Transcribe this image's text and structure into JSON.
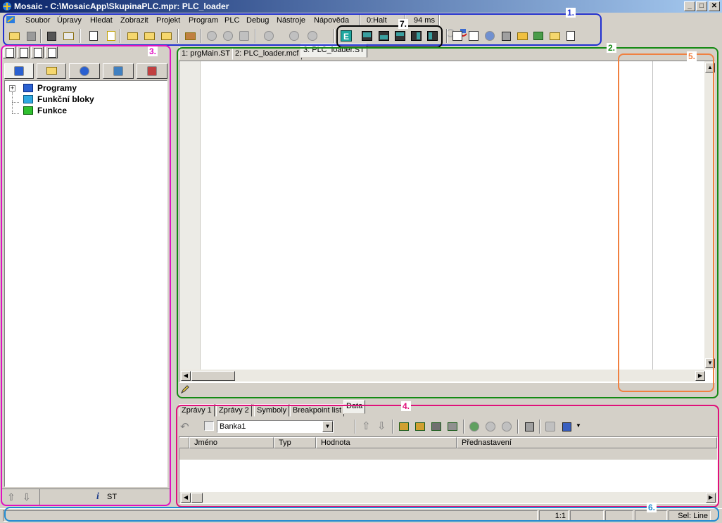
{
  "window": {
    "title": "Mosaic - C:\\MosaicApp\\SkupinaPLC.mpr: PLC_loader",
    "minimize": "_",
    "maximize": "□",
    "close": "✕"
  },
  "menu": {
    "items": [
      "Soubor",
      "Úpravy",
      "Hledat",
      "Zobrazit",
      "Projekt",
      "Program",
      "PLC",
      "Debug",
      "Nástroje",
      "Nápověda"
    ],
    "plc_state": "0:Halt",
    "cycle_time": "94 ms"
  },
  "annotations": {
    "one": "1.",
    "two": "2.",
    "three": "3.",
    "four": "4.",
    "five": "5.",
    "six": "6.",
    "seven": "7."
  },
  "annotation_colors": {
    "one": "#1f2fd0",
    "two": "#138a13",
    "three": "#e010c0",
    "four": "#e0107a",
    "five": "#f08040",
    "six": "#1f8ad0",
    "seven": "#000000"
  },
  "editor": {
    "tabs": [
      "1: prgMain.ST",
      "2: PLC_loader.mcf",
      "3: PLC_loader.ST"
    ],
    "active_tab": 2
  },
  "project_tree": {
    "items": [
      "Programy",
      "Funkční bloky",
      "Funkce"
    ],
    "footer_label": "ST"
  },
  "bottom_panel": {
    "tabs": [
      "Zprávy 1",
      "Zprávy 2",
      "Symboly",
      "Breakpoint list",
      "Data"
    ],
    "active_tab": 4,
    "bank_select": "Banka1",
    "columns": [
      "Jméno",
      "Typ",
      "Hodnota",
      "Přednastavení"
    ]
  },
  "statusbar": {
    "zoom": "1:1",
    "selection": "Sel: Line"
  }
}
